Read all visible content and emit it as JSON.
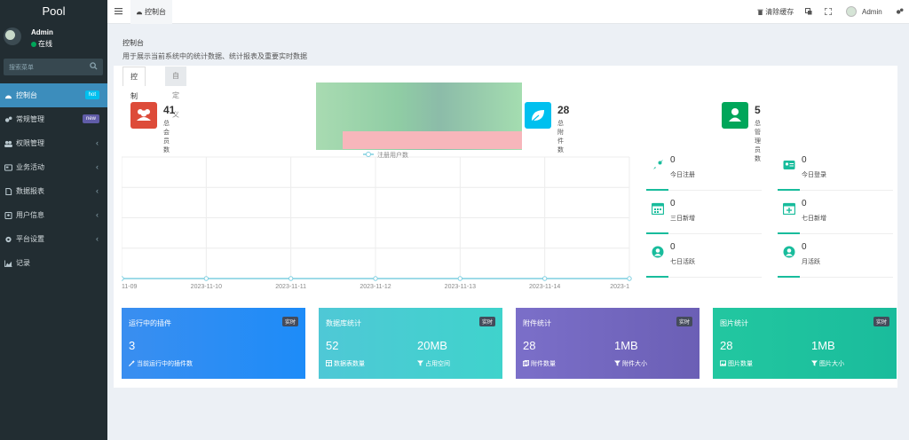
{
  "sidebar": {
    "logo": "Pool",
    "user_name": "Admin",
    "user_status": "在线",
    "search_placeholder": "搜索菜单",
    "items": [
      {
        "label": "控制台",
        "badge": "hot"
      },
      {
        "label": "常规管理",
        "badge": "new"
      },
      {
        "label": "权限管理"
      },
      {
        "label": "业务活动"
      },
      {
        "label": "数据报表"
      },
      {
        "label": "用户信息"
      },
      {
        "label": "平台设置"
      },
      {
        "label": "记录"
      }
    ]
  },
  "topbar": {
    "tab_label": "控制台",
    "clear_cache": "清除缓存",
    "user_name": "Admin"
  },
  "page": {
    "title": "控制台",
    "subtitle": "用于展示当前系统中的统计数据、统计报表及重要实时数据",
    "tabs": [
      "控制台",
      "自定义"
    ]
  },
  "stats_top": [
    {
      "value": "41",
      "label": "总会员数",
      "color": "#dd4b39"
    },
    {
      "value": "28",
      "label": "总附件数",
      "color": "#00c0ef"
    },
    {
      "value": "5",
      "label": "总管理员数",
      "color": "#00a65a"
    }
  ],
  "chart_data": {
    "type": "line",
    "legend": "注册用户数",
    "categories": [
      "11-09",
      "2023-11-10",
      "2023-11-11",
      "2023-11-12",
      "2023-11-13",
      "2023-11-14",
      "2023-1"
    ],
    "series": [
      {
        "name": "注册用户数",
        "values": [
          0,
          0,
          0,
          0,
          0,
          0,
          0
        ]
      }
    ],
    "grid": true
  },
  "stats_right": [
    {
      "value": "0",
      "label": "今日注册",
      "icon": "rocket-icon"
    },
    {
      "value": "0",
      "label": "今日登录",
      "icon": "id-card-icon"
    },
    {
      "value": "0",
      "label": "三日新增",
      "icon": "calendar-icon"
    },
    {
      "value": "0",
      "label": "七日新增",
      "icon": "calendar-plus-icon"
    },
    {
      "value": "0",
      "label": "七日活跃",
      "icon": "user-circle-icon"
    },
    {
      "value": "0",
      "label": "月活跃",
      "icon": "user-circle-icon"
    }
  ],
  "cards": [
    {
      "title": "运行中的插件",
      "tag": "实时",
      "values": [
        "3"
      ],
      "subs": [
        "当前运行中的插件数"
      ]
    },
    {
      "title": "数据库统计",
      "tag": "实时",
      "values": [
        "52",
        "20MB"
      ],
      "subs": [
        "数据表数量",
        "占用空间"
      ]
    },
    {
      "title": "附件统计",
      "tag": "实时",
      "values": [
        "28",
        "1MB"
      ],
      "subs": [
        "附件数量",
        "附件大小"
      ]
    },
    {
      "title": "图片统计",
      "tag": "实时",
      "values": [
        "28",
        "1MB"
      ],
      "subs": [
        "图片数量",
        "图片大小"
      ]
    }
  ]
}
